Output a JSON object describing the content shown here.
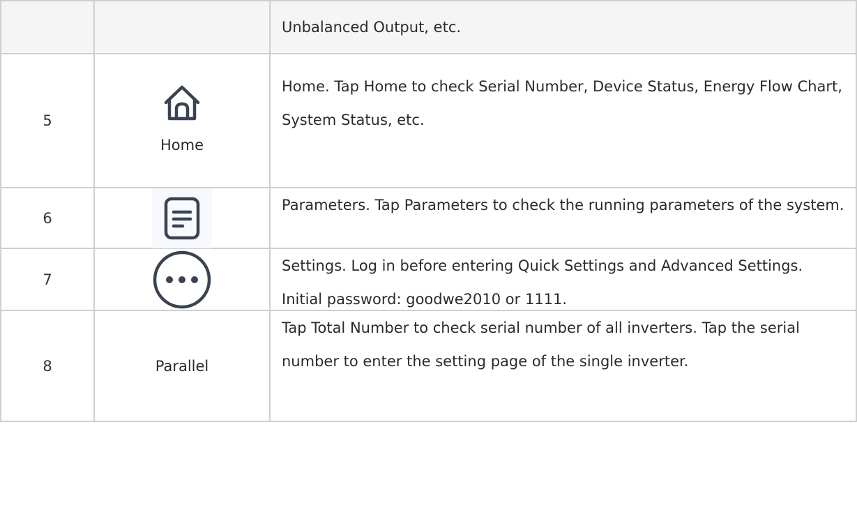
{
  "rows": [
    {
      "number": "",
      "icon": "",
      "label": "",
      "description": "Unbalanced Output, etc."
    },
    {
      "number": "5",
      "icon": "home-icon",
      "label": "Home",
      "description": "Home. Tap Home to check Serial Number, Device Status, Energy Flow Chart, System Status, etc."
    },
    {
      "number": "6",
      "icon": "document-icon",
      "label": "",
      "description": "Parameters. Tap Parameters to check the running parameters of the system."
    },
    {
      "number": "7",
      "icon": "more-icon",
      "label": "",
      "description": "Settings. Log in before entering Quick Settings and Advanced Settings. Initial password: goodwe2010 or 1111."
    },
    {
      "number": "8",
      "icon": "",
      "label": "Parallel",
      "description": "Tap Total Number to check serial number of all inverters. Tap the serial number to enter the setting page of the single inverter."
    }
  ],
  "colors": {
    "border": "#cfcfcf",
    "highlight_row": "#f5f5f5",
    "icon_stroke": "#3a4352",
    "text": "#2b2b2b"
  }
}
